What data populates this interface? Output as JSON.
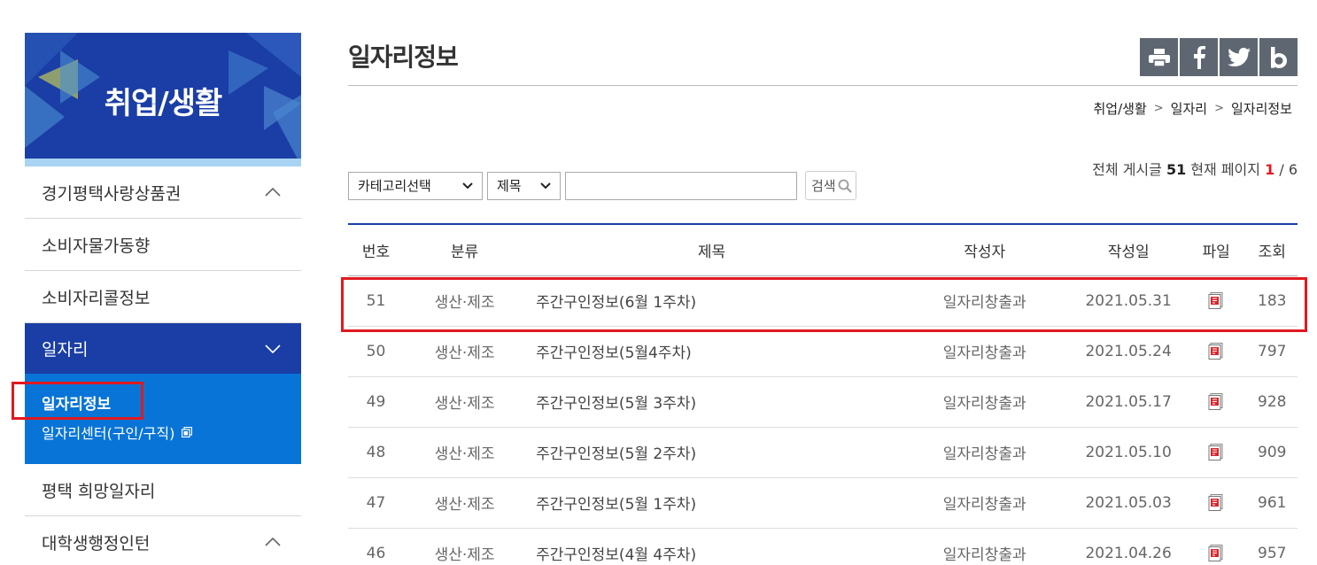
{
  "sidebar": {
    "banner_title": "취업/생활",
    "items": [
      {
        "label": "경기평택사랑상품권",
        "state": "collapsed"
      },
      {
        "label": "소비자물가동향"
      },
      {
        "label": "소비자리콜정보"
      },
      {
        "label": "일자리",
        "state": "expanded"
      },
      {
        "label": "평택 희망일자리"
      },
      {
        "label": "대학생행정인턴",
        "state": "collapsed"
      }
    ],
    "submenu": [
      {
        "label": "일자리정보",
        "selected": true
      },
      {
        "label": "일자리센터(구인/구직)",
        "external": true
      }
    ]
  },
  "main": {
    "page_title": "일자리정보",
    "share_icons": [
      "print-icon",
      "facebook-icon",
      "twitter-icon",
      "blog-icon"
    ],
    "breadcrumb": [
      "취업/생활",
      "일자리",
      "일자리정보"
    ],
    "breadcrumb_sep": ">",
    "search": {
      "category_select": "카테고리선택",
      "field_select": "제목",
      "query": "",
      "button_label": "검색"
    },
    "count": {
      "total_label": "전체 게시글",
      "total": "51",
      "page_label": "현재 페이지",
      "current": "1",
      "slash": "/",
      "pages": "6"
    },
    "table": {
      "headers": [
        "번호",
        "분류",
        "제목",
        "작성자",
        "작성일",
        "파일",
        "조회"
      ],
      "rows": [
        {
          "no": "51",
          "category": "생산·제조",
          "title": "주간구인정보(6월 1주차)",
          "author": "일자리창출과",
          "date": "2021.05.31",
          "views": "183"
        },
        {
          "no": "50",
          "category": "생산·제조",
          "title": "주간구인정보(5월4주차)",
          "author": "일자리창출과",
          "date": "2021.05.24",
          "views": "797"
        },
        {
          "no": "49",
          "category": "생산·제조",
          "title": "주간구인정보(5월 3주차)",
          "author": "일자리창출과",
          "date": "2021.05.17",
          "views": "928"
        },
        {
          "no": "48",
          "category": "생산·제조",
          "title": "주간구인정보(5월 2주차)",
          "author": "일자리창출과",
          "date": "2021.05.10",
          "views": "909"
        },
        {
          "no": "47",
          "category": "생산·제조",
          "title": "주간구인정보(5월 1주차)",
          "author": "일자리창출과",
          "date": "2021.05.03",
          "views": "961"
        },
        {
          "no": "46",
          "category": "생산·제조",
          "title": "주간구인정보(4월 4주차)",
          "author": "일자리창출과",
          "date": "2021.04.26",
          "views": "957"
        }
      ]
    }
  },
  "colors": {
    "nav_blue": "#1a3ea5",
    "sub_blue": "#0874d7",
    "highlight_red": "#e0191f",
    "share_gray": "#5e6771"
  }
}
